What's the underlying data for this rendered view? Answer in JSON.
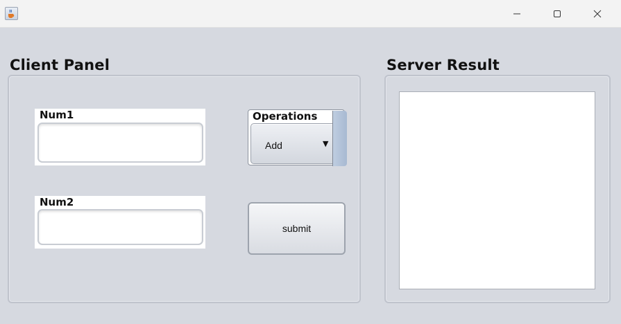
{
  "window": {
    "title": "",
    "icons": {
      "app": "java-cup-icon",
      "minimize": "minimize-icon",
      "maximize": "maximize-icon",
      "close": "close-icon"
    }
  },
  "client_panel": {
    "heading": "Client Panel",
    "num1": {
      "label": "Num1",
      "value": ""
    },
    "num2": {
      "label": "Num2",
      "value": ""
    },
    "operations": {
      "label": "Operations",
      "selected": "Add",
      "arrow_icon": "dropdown-arrow-icon"
    },
    "submit_label": "submit"
  },
  "server_panel": {
    "heading": "Server Result",
    "result_text": ""
  },
  "colors": {
    "background": "#d6d9e0",
    "titlebar": "#f3f3f3",
    "field": "#ffffff"
  }
}
